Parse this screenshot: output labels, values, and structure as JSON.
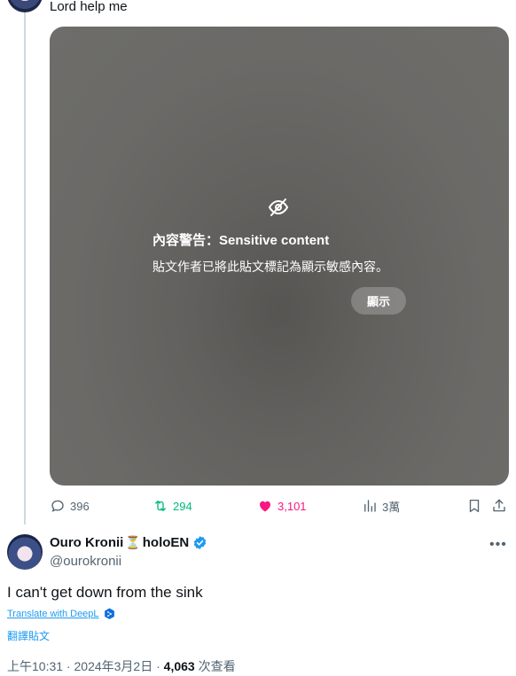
{
  "previous_post": {
    "text": "Lord help me"
  },
  "media": {
    "warning_title": "內容警告：Sensitive content",
    "warning_text": "貼文作者已將此貼文標記為顯示敏感內容。",
    "show_label": "顯示"
  },
  "actions": {
    "replies": "396",
    "reposts": "294",
    "likes": "3,101",
    "views": "3萬"
  },
  "author": {
    "name": "Ouro Kronii",
    "badge_emoji": "⏳",
    "affiliation": "holoEN",
    "handle": "@ourokronii"
  },
  "tweet": {
    "text": "I can't get down from the sink",
    "translate_deepl": "Translate with DeepL",
    "translate_post": "翻譯貼文"
  },
  "meta": {
    "time": "上午10:31",
    "date": "2024年3月2日",
    "separator": " · ",
    "view_count": "4,063",
    "view_label": " 次查看"
  },
  "colors": {
    "link": "#1d9bf0",
    "repost": "#00ba7c",
    "like": "#f91880",
    "muted": "#536471"
  }
}
